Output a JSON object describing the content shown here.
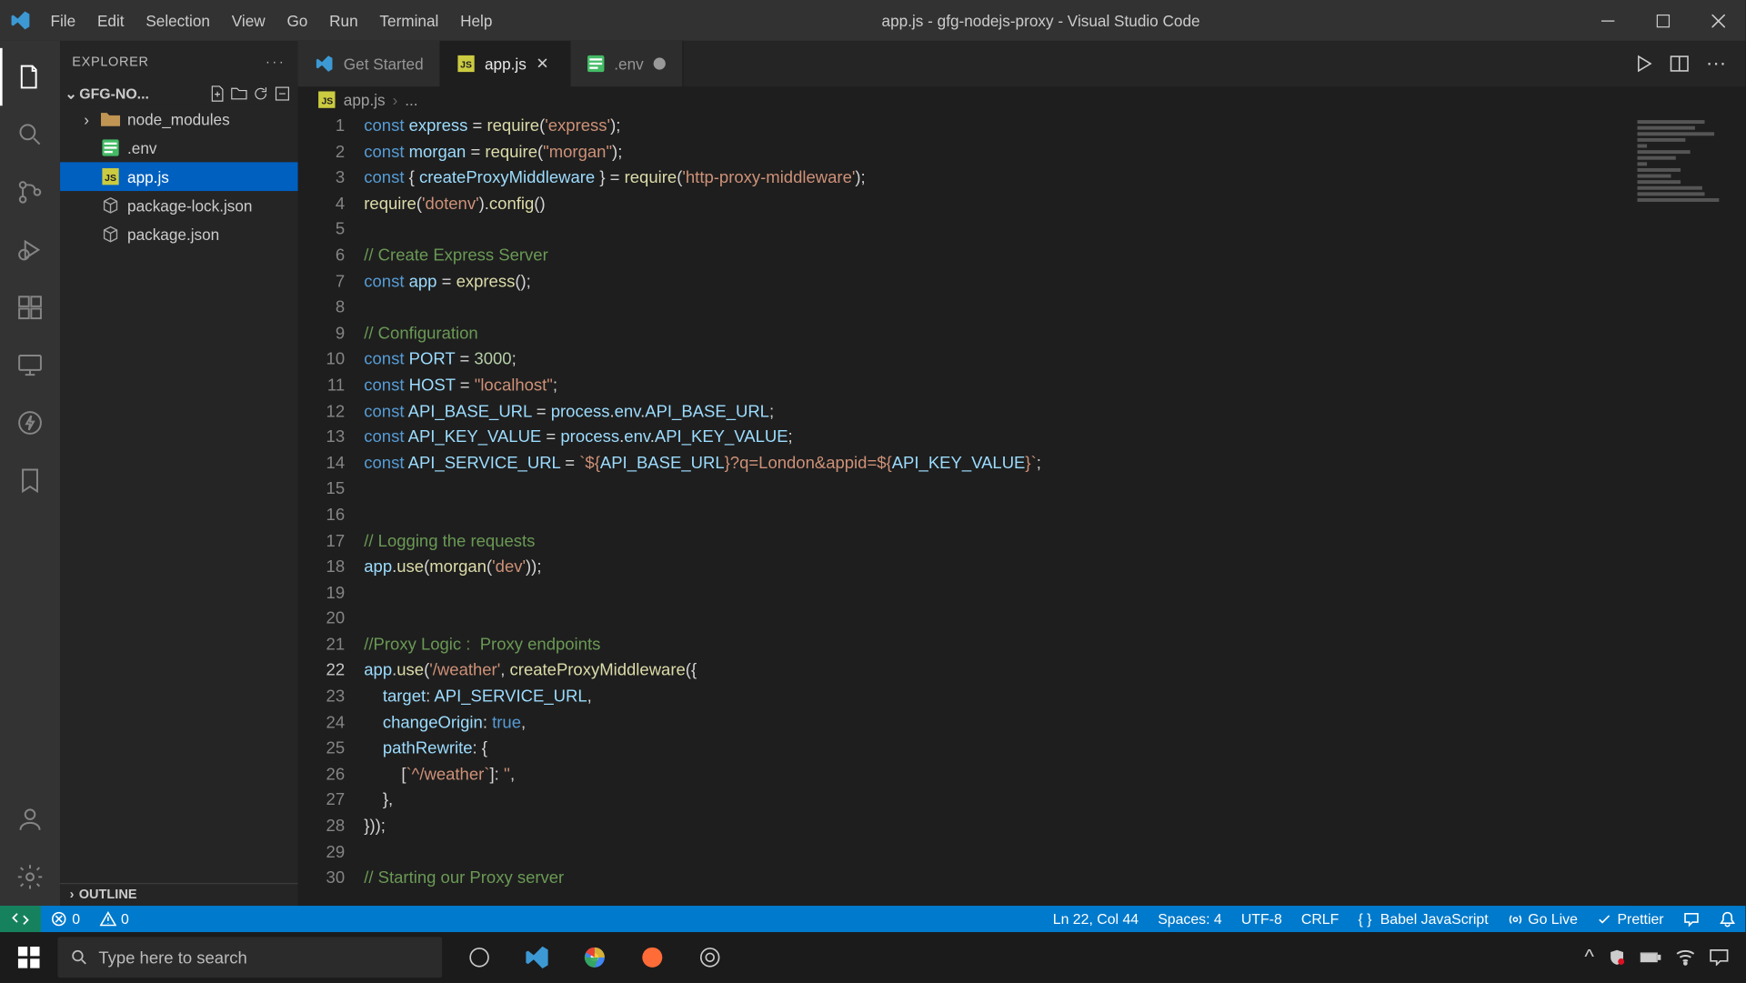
{
  "titlebar": {
    "menus": [
      "File",
      "Edit",
      "Selection",
      "View",
      "Go",
      "Run",
      "Terminal",
      "Help"
    ],
    "title": "app.js - gfg-nodejs-proxy - Visual Studio Code"
  },
  "sidebar": {
    "header": "EXPLORER",
    "folder": "GFG-NO...",
    "items": [
      {
        "name": "node_modules",
        "icon": "folder",
        "indent": false,
        "chev": "›"
      },
      {
        "name": ".env",
        "icon": "env",
        "indent": false,
        "chev": ""
      },
      {
        "name": "app.js",
        "icon": "js",
        "indent": false,
        "chev": "",
        "selected": true
      },
      {
        "name": "package-lock.json",
        "icon": "pkg",
        "indent": false,
        "chev": ""
      },
      {
        "name": "package.json",
        "icon": "pkg",
        "indent": false,
        "chev": ""
      }
    ],
    "outline": "OUTLINE"
  },
  "tabs": [
    {
      "label": "Get Started",
      "icon": "vscode",
      "active": false,
      "close": false
    },
    {
      "label": "app.js",
      "icon": "js",
      "active": true,
      "close": true,
      "dirty": false
    },
    {
      "label": ".env",
      "icon": "env",
      "active": false,
      "close": false,
      "dirty": true
    }
  ],
  "breadcrumb": {
    "file": "app.js",
    "rest": "..."
  },
  "code": {
    "lines": [
      {
        "n": 1,
        "seg": [
          [
            "kw",
            "const"
          ],
          [
            "pun",
            " "
          ],
          [
            "var",
            "express"
          ],
          [
            "pun",
            " = "
          ],
          [
            "fn",
            "require"
          ],
          [
            "pun",
            "("
          ],
          [
            "str",
            "'express'"
          ],
          [
            "pun",
            ");"
          ]
        ]
      },
      {
        "n": 2,
        "seg": [
          [
            "kw",
            "const"
          ],
          [
            "pun",
            " "
          ],
          [
            "var",
            "morgan"
          ],
          [
            "pun",
            " = "
          ],
          [
            "fn",
            "require"
          ],
          [
            "pun",
            "("
          ],
          [
            "str",
            "\"morgan\""
          ],
          [
            "pun",
            ");"
          ]
        ]
      },
      {
        "n": 3,
        "seg": [
          [
            "kw",
            "const"
          ],
          [
            "pun",
            " { "
          ],
          [
            "var",
            "createProxyMiddleware"
          ],
          [
            "pun",
            " } = "
          ],
          [
            "fn",
            "require"
          ],
          [
            "pun",
            "("
          ],
          [
            "str",
            "'http-proxy-middleware'"
          ],
          [
            "pun",
            ");"
          ]
        ]
      },
      {
        "n": 4,
        "seg": [
          [
            "fn",
            "require"
          ],
          [
            "pun",
            "("
          ],
          [
            "str",
            "'dotenv'"
          ],
          [
            "pun",
            ")."
          ],
          [
            "fn",
            "config"
          ],
          [
            "pun",
            "()"
          ]
        ]
      },
      {
        "n": 5,
        "seg": []
      },
      {
        "n": 6,
        "seg": [
          [
            "com",
            "// Create Express Server"
          ]
        ]
      },
      {
        "n": 7,
        "seg": [
          [
            "kw",
            "const"
          ],
          [
            "pun",
            " "
          ],
          [
            "var",
            "app"
          ],
          [
            "pun",
            " = "
          ],
          [
            "fn",
            "express"
          ],
          [
            "pun",
            "();"
          ]
        ]
      },
      {
        "n": 8,
        "seg": []
      },
      {
        "n": 9,
        "seg": [
          [
            "com",
            "// Configuration"
          ]
        ]
      },
      {
        "n": 10,
        "seg": [
          [
            "kw",
            "const"
          ],
          [
            "pun",
            " "
          ],
          [
            "var",
            "PORT"
          ],
          [
            "pun",
            " = "
          ],
          [
            "num",
            "3000"
          ],
          [
            "pun",
            ";"
          ]
        ]
      },
      {
        "n": 11,
        "seg": [
          [
            "kw",
            "const"
          ],
          [
            "pun",
            " "
          ],
          [
            "var",
            "HOST"
          ],
          [
            "pun",
            " = "
          ],
          [
            "str",
            "\"localhost\""
          ],
          [
            "pun",
            ";"
          ]
        ]
      },
      {
        "n": 12,
        "seg": [
          [
            "kw",
            "const"
          ],
          [
            "pun",
            " "
          ],
          [
            "var",
            "API_BASE_URL"
          ],
          [
            "pun",
            " = "
          ],
          [
            "var",
            "process"
          ],
          [
            "pun",
            "."
          ],
          [
            "prop",
            "env"
          ],
          [
            "pun",
            "."
          ],
          [
            "var",
            "API_BASE_URL"
          ],
          [
            "pun",
            ";"
          ]
        ]
      },
      {
        "n": 13,
        "seg": [
          [
            "kw",
            "const"
          ],
          [
            "pun",
            " "
          ],
          [
            "var",
            "API_KEY_VALUE"
          ],
          [
            "pun",
            " = "
          ],
          [
            "var",
            "process"
          ],
          [
            "pun",
            "."
          ],
          [
            "prop",
            "env"
          ],
          [
            "pun",
            "."
          ],
          [
            "var",
            "API_KEY_VALUE"
          ],
          [
            "pun",
            ";"
          ]
        ]
      },
      {
        "n": 14,
        "seg": [
          [
            "kw",
            "const"
          ],
          [
            "pun",
            " "
          ],
          [
            "var",
            "API_SERVICE_URL"
          ],
          [
            "pun",
            " = "
          ],
          [
            "str",
            "`${"
          ],
          [
            "var",
            "API_BASE_URL"
          ],
          [
            "str",
            "}?q=London&appid=${"
          ],
          [
            "var",
            "API_KEY_VALUE"
          ],
          [
            "str",
            "}`"
          ],
          [
            "pun",
            ";"
          ]
        ]
      },
      {
        "n": 15,
        "seg": []
      },
      {
        "n": 16,
        "seg": []
      },
      {
        "n": 17,
        "seg": [
          [
            "com",
            "// Logging the requests"
          ]
        ]
      },
      {
        "n": 18,
        "seg": [
          [
            "var",
            "app"
          ],
          [
            "pun",
            "."
          ],
          [
            "fn",
            "use"
          ],
          [
            "pun",
            "("
          ],
          [
            "fn",
            "morgan"
          ],
          [
            "pun",
            "("
          ],
          [
            "str",
            "'dev'"
          ],
          [
            "pun",
            "));"
          ]
        ]
      },
      {
        "n": 19,
        "seg": []
      },
      {
        "n": 20,
        "seg": []
      },
      {
        "n": 21,
        "seg": [
          [
            "com",
            "//Proxy Logic :  Proxy endpoints"
          ]
        ]
      },
      {
        "n": 22,
        "seg": [
          [
            "var",
            "app"
          ],
          [
            "pun",
            "."
          ],
          [
            "fn",
            "use"
          ],
          [
            "pun",
            "("
          ],
          [
            "str",
            "'/weather'"
          ],
          [
            "pun",
            ", "
          ],
          [
            "fn",
            "createProxyMiddleware"
          ],
          [
            "pun",
            "({"
          ]
        ],
        "current": true
      },
      {
        "n": 23,
        "seg": [
          [
            "pun",
            "    "
          ],
          [
            "prop",
            "target"
          ],
          [
            "pun",
            ": "
          ],
          [
            "var",
            "API_SERVICE_URL"
          ],
          [
            "pun",
            ","
          ]
        ]
      },
      {
        "n": 24,
        "seg": [
          [
            "pun",
            "    "
          ],
          [
            "prop",
            "changeOrigin"
          ],
          [
            "pun",
            ": "
          ],
          [
            "bool",
            "true"
          ],
          [
            "pun",
            ","
          ]
        ]
      },
      {
        "n": 25,
        "seg": [
          [
            "pun",
            "    "
          ],
          [
            "prop",
            "pathRewrite"
          ],
          [
            "pun",
            ": {"
          ]
        ]
      },
      {
        "n": 26,
        "seg": [
          [
            "pun",
            "        ["
          ],
          [
            "str",
            "`^/weather`"
          ],
          [
            "pun",
            "]: "
          ],
          [
            "str",
            "''"
          ],
          [
            "pun",
            ","
          ]
        ]
      },
      {
        "n": 27,
        "seg": [
          [
            "pun",
            "    },"
          ]
        ]
      },
      {
        "n": 28,
        "seg": [
          [
            "pun",
            "}));"
          ]
        ]
      },
      {
        "n": 29,
        "seg": []
      },
      {
        "n": 30,
        "seg": [
          [
            "com",
            "// Starting our Proxy server"
          ]
        ]
      }
    ]
  },
  "statusbar": {
    "errors": "0",
    "warnings": "0",
    "lncol": "Ln 22, Col 44",
    "spaces": "Spaces: 4",
    "encoding": "UTF-8",
    "eol": "CRLF",
    "lang": "Babel JavaScript",
    "golive": "Go Live",
    "prettier": "Prettier"
  },
  "taskbar": {
    "search_placeholder": "Type here to search"
  }
}
